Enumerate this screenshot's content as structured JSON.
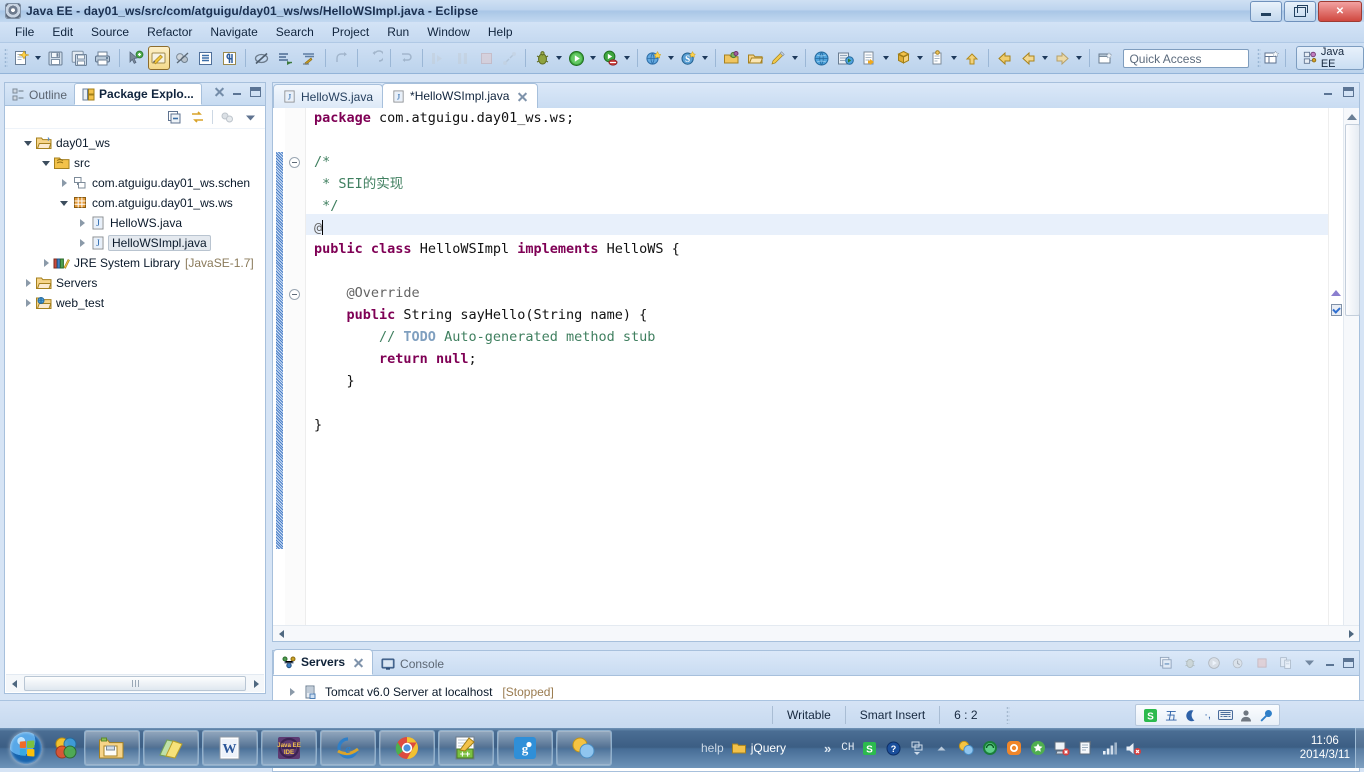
{
  "window": {
    "title": "Java EE - day01_ws/src/com/atguigu/day01_ws/ws/HelloWSImpl.java - Eclipse",
    "app_icon": "eclipse-icon",
    "minimize_label": "Minimize",
    "maximize_label": "Maximize",
    "close_label": "Close"
  },
  "menubar": {
    "items": [
      {
        "label": "File"
      },
      {
        "label": "Edit"
      },
      {
        "label": "Source"
      },
      {
        "label": "Refactor"
      },
      {
        "label": "Navigate"
      },
      {
        "label": "Search"
      },
      {
        "label": "Project"
      },
      {
        "label": "Run"
      },
      {
        "label": "Window"
      },
      {
        "label": "Help"
      }
    ]
  },
  "toolbar": {
    "quick_access_placeholder": "Quick Access",
    "quick_access_value": "",
    "perspective_label": "Java EE",
    "open_perspective_tooltip": "Open Perspective",
    "icons": [
      "new-wizard-icon",
      "save-icon",
      "save-all-icon",
      "print-icon",
      "toggle-java-ee-icon",
      "toggle-mark-occurrences-icon",
      "skip-all-breakpoints-icon",
      "show-whitespace-icon",
      "block-selection-icon",
      "next-annotation-icon",
      "previous-annotation-icon",
      "last-edit-location-icon",
      "back-icon",
      "forward-icon",
      "step-over-icon",
      "pause-icon",
      "terminate-icon",
      "disconnect-icon",
      "debug-icon",
      "run-icon",
      "run-as-icon",
      "new-server-icon",
      "search-icon",
      "open-type-icon",
      "open-task-icon",
      "new-java-project-icon",
      "new-web-project-icon",
      "new-class-icon",
      "new-annotation-icon",
      "new-package-icon",
      "new-window-icon"
    ]
  },
  "left_view": {
    "tabs": [
      {
        "label": "Outline",
        "icon": "outline-icon",
        "active": false
      },
      {
        "label": "Package Explo...",
        "icon": "package-explorer-icon",
        "active": true
      }
    ],
    "view_toolbar": [
      "collapse-all-icon",
      "link-with-editor-icon",
      "view-menu-icon",
      "focus-icon"
    ],
    "tree": [
      {
        "label": "day01_ws",
        "icon": "java-project-icon",
        "indent": 0,
        "twisty": "open",
        "selected": false
      },
      {
        "label": "src",
        "icon": "source-folder-icon",
        "indent": 1,
        "twisty": "open",
        "selected": false
      },
      {
        "label": "com.atguigu.day01_ws.schen",
        "icon": "package-empty-icon",
        "indent": 2,
        "twisty": "closed",
        "selected": false
      },
      {
        "label": "com.atguigu.day01_ws.ws",
        "icon": "package-icon",
        "indent": 2,
        "twisty": "open",
        "selected": false
      },
      {
        "label": "HelloWS.java",
        "icon": "java-file-icon",
        "indent": 3,
        "twisty": "closed",
        "selected": false
      },
      {
        "label": "HelloWSImpl.java",
        "icon": "java-file-icon",
        "indent": 3,
        "twisty": "closed",
        "selected": true
      },
      {
        "label": "JRE System Library",
        "suffix": "[JavaSE-1.7]",
        "icon": "jre-library-icon",
        "indent": 1,
        "twisty": "closed",
        "selected": false
      },
      {
        "label": "Servers",
        "icon": "folder-icon",
        "indent": 0,
        "twisty": "closed",
        "selected": false
      },
      {
        "label": "web_test",
        "icon": "web-project-icon",
        "indent": 0,
        "twisty": "closed",
        "selected": false
      }
    ]
  },
  "editor": {
    "tabs": [
      {
        "label": "HelloWS.java",
        "icon": "java-file-icon",
        "active": false,
        "dirty": false
      },
      {
        "label": "*HelloWSImpl.java",
        "icon": "java-file-icon",
        "active": true,
        "dirty": true
      }
    ],
    "close_icon": "close-icon",
    "code_lines": [
      {
        "text": "package com.atguigu.day01_ws.ws;"
      },
      {
        "text": ""
      },
      {
        "text": "/*"
      },
      {
        "text": " * SEI的实现"
      },
      {
        "text": " */"
      },
      {
        "text": "@"
      },
      {
        "text": "public class HelloWSImpl implements HelloWS {"
      },
      {
        "text": ""
      },
      {
        "text": "    @Override"
      },
      {
        "text": "    public String sayHello(String name) {"
      },
      {
        "text": "        // TODO Auto-generated method stub"
      },
      {
        "text": "        return null;"
      },
      {
        "text": "    }"
      },
      {
        "text": ""
      },
      {
        "text": "}"
      }
    ],
    "highlighted_line": 6
  },
  "bottom_view": {
    "tabs": [
      {
        "label": "Servers",
        "icon": "servers-icon",
        "active": true
      },
      {
        "label": "Console",
        "icon": "console-icon",
        "active": false
      }
    ],
    "toolbar_icons": [
      "collapse-all-icon",
      "debug-server-icon",
      "start-server-icon",
      "profile-server-icon",
      "stop-server-icon",
      "publish-icon",
      "view-menu-icon",
      "minimize-icon",
      "maximize-icon"
    ],
    "rows": [
      {
        "name": "Tomcat v6.0 Server at localhost",
        "status": "[Stopped]",
        "icon": "server-icon"
      }
    ]
  },
  "statusbar": {
    "writable": "Writable",
    "insert_mode": "Smart Insert",
    "cursor_position": "6 : 2",
    "ime_items": [
      "sogou-icon",
      "wubi-icon",
      "moon-icon",
      "punctuation-icon",
      "keyboard-icon",
      "user-icon",
      "wrench-icon"
    ]
  },
  "taskbar": {
    "start_tooltip": "Start",
    "quick_launch": [
      "show-desktop-icon",
      "windows-flip-icon"
    ],
    "buttons": [
      {
        "icon": "explorer-icon",
        "label": ""
      },
      {
        "icon": "sticky-notes-icon",
        "label": ""
      },
      {
        "icon": "word-icon",
        "label": ""
      },
      {
        "icon": "eclipse-javaee-icon",
        "label": ""
      },
      {
        "icon": "internet-explorer-icon",
        "label": ""
      },
      {
        "icon": "chrome-icon",
        "label": ""
      },
      {
        "icon": "notepadpp-icon",
        "label": ""
      },
      {
        "icon": "qq-icon",
        "label": ""
      },
      {
        "icon": "messenger-icon",
        "label": ""
      }
    ],
    "help_label": "help",
    "jquery_label": "jQuery",
    "overflow_label": "»",
    "tray": {
      "language": "CH",
      "icons": [
        "sogou-s-icon",
        "help-icon",
        "expand-icon",
        "show-hidden-icon",
        "qq-icon",
        "wechat-icon",
        "security-icon",
        "360-icon",
        "network-error-icon",
        "clipboard-icon",
        "signal-icon",
        "volume-mute-icon"
      ]
    },
    "clock": {
      "time": "11:06",
      "date": "2014/3/11"
    }
  },
  "colors": {
    "keyword": "#7f0055",
    "comment": "#3f7f5f",
    "todo": "#7f9fbf",
    "annotation": "#646464",
    "highlight_line": "#e8f0fb",
    "accent": "#3c5e84"
  }
}
